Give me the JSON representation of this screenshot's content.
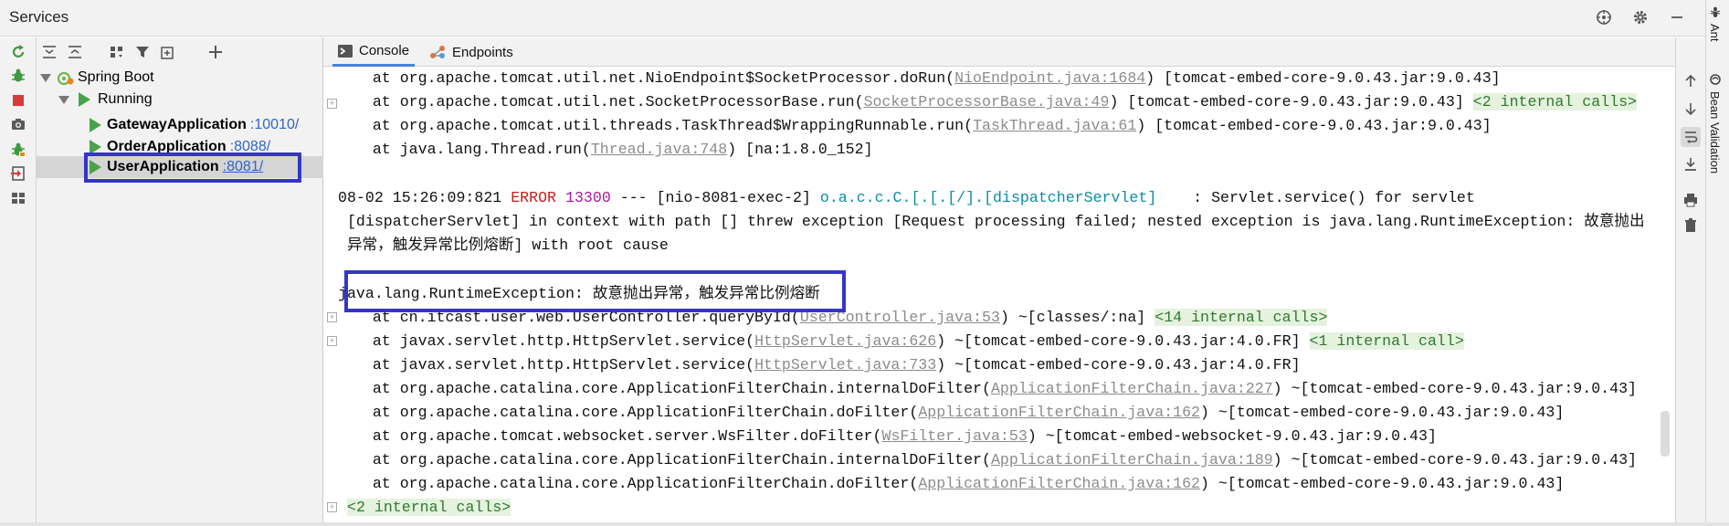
{
  "window": {
    "title": "Services"
  },
  "side_strip": {
    "ant_label": "Ant",
    "bean_label": "Bean Validation"
  },
  "tree": {
    "nodes": [
      {
        "label": "Spring Boot"
      },
      {
        "label": "Running"
      },
      {
        "name": "GatewayApplication",
        "port": ":10010/"
      },
      {
        "name": "OrderApplication",
        "port": ":8088/"
      },
      {
        "name": "UserApplication",
        "port": ":8081/",
        "selected": true
      }
    ]
  },
  "tabs": [
    {
      "label": "Console",
      "active": true
    },
    {
      "label": "Endpoints",
      "active": false
    }
  ],
  "console": {
    "stack_top": [
      {
        "pre": "    at org.apache.tomcat.util.net.NioEndpoint$SocketProcessor.doRun(",
        "link": "NioEndpoint.java:1684",
        "post": ") [tomcat-embed-core-9.0.43.jar:9.0.43]",
        "ic": ""
      },
      {
        "pre": "    at org.apache.tomcat.util.net.SocketProcessorBase.run(",
        "link": "SocketProcessorBase.java:49",
        "post": ") [tomcat-embed-core-9.0.43.jar:9.0.43] ",
        "ic": "<2 internal calls>"
      },
      {
        "pre": "    at org.apache.tomcat.util.threads.TaskThread$WrappingRunnable.run(",
        "link": "TaskThread.java:61",
        "post": ") [tomcat-embed-core-9.0.43.jar:9.0.43]",
        "ic": ""
      },
      {
        "pre": "    at java.lang.Thread.run(",
        "link": "Thread.java:748",
        "post": ") [na:1.8.0_152]",
        "ic": ""
      }
    ],
    "log": {
      "timestamp": "08-02 15:26:09:821",
      "level": "ERROR",
      "pid": "13300",
      "sep": "---",
      "thread": "[nio-8081-exec-2]",
      "logger": "o.a.c.c.C.[.[.[/].[dispatcherServlet]",
      "message": "   : Servlet.service() for servlet",
      "cont1": " [dispatcherServlet] in context with path [] threw exception [Request processing failed; nested exception is java.lang.RuntimeException: 故意抛出",
      "cont2": " 异常，触发异常比例熔断] with root cause"
    },
    "exception": "java.lang.RuntimeException: 故意抛出异常，触发异常比例熔断",
    "stack_bottom": [
      {
        "pre": "    at cn.itcast.user.web.UserController.queryById(",
        "link": "UserController.java:53",
        "post": ") ~[classes/:na] ",
        "ic": "<14 internal calls>"
      },
      {
        "pre": "    at javax.servlet.http.HttpServlet.service(",
        "link": "HttpServlet.java:626",
        "post": ") ~[tomcat-embed-core-9.0.43.jar:4.0.FR] ",
        "ic": "<1 internal call>"
      },
      {
        "pre": "    at javax.servlet.http.HttpServlet.service(",
        "link": "HttpServlet.java:733",
        "post": ") ~[tomcat-embed-core-9.0.43.jar:4.0.FR]",
        "ic": ""
      },
      {
        "pre": "    at org.apache.catalina.core.ApplicationFilterChain.internalDoFilter(",
        "link": "ApplicationFilterChain.java:227",
        "post": ") ~[tomcat-embed-core-9.0.43.jar:9.0.43]",
        "ic": ""
      },
      {
        "pre": "    at org.apache.catalina.core.ApplicationFilterChain.doFilter(",
        "link": "ApplicationFilterChain.java:162",
        "post": ") ~[tomcat-embed-core-9.0.43.jar:9.0.43]",
        "ic": ""
      },
      {
        "pre": "    at org.apache.tomcat.websocket.server.WsFilter.doFilter(",
        "link": "WsFilter.java:53",
        "post": ") ~[tomcat-embed-websocket-9.0.43.jar:9.0.43]",
        "ic": ""
      },
      {
        "pre": "    at org.apache.catalina.core.ApplicationFilterChain.internalDoFilter(",
        "link": "ApplicationFilterChain.java:189",
        "post": ") ~[tomcat-embed-core-9.0.43.jar:9.0.43]",
        "ic": ""
      },
      {
        "pre": "    at org.apache.catalina.core.ApplicationFilterChain.doFilter(",
        "link": "ApplicationFilterChain.java:162",
        "post": ") ~[tomcat-embed-core-9.0.43.jar:9.0.43]",
        "ic": ""
      }
    ],
    "trailing_ic": "<2 internal calls>"
  },
  "colors": {
    "highlight_box": "#3535c8",
    "run_green": "#4aa34a",
    "error_red": "#c4201c",
    "link_gray": "#8c8c8c",
    "internal_calls_bg": "#e5f2de"
  },
  "icons": [
    "rerun-icon",
    "debug-icon",
    "stop-icon",
    "camera-icon",
    "bug-icon",
    "login-icon",
    "layout-icon",
    "expand-all-icon",
    "collapse-all-icon",
    "group-icon",
    "filter-icon",
    "new-tab-icon",
    "add-icon",
    "globe-icon",
    "gear-icon",
    "minimize-icon",
    "up-arrow-icon",
    "down-arrow-icon",
    "soft-wrap-icon",
    "scroll-to-end-icon",
    "print-icon",
    "trash-icon"
  ]
}
